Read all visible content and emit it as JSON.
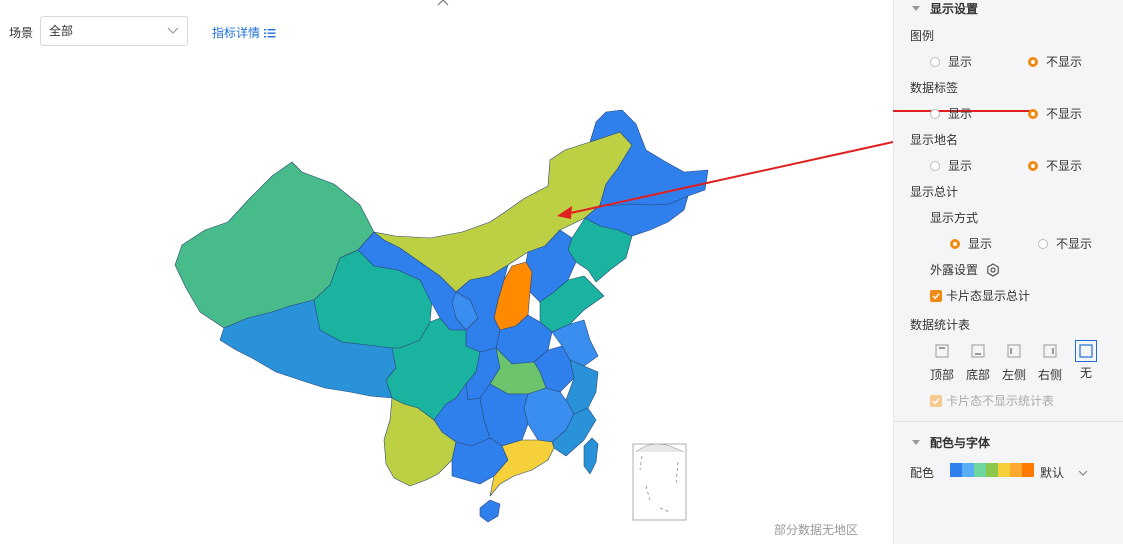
{
  "toolbar": {
    "scene_label": "场景",
    "scene_value": "全部",
    "metric_link": "指标详情"
  },
  "map": {
    "nodata_text": "部分数据无地区",
    "colors": {
      "blue": "#2f80ed",
      "blue_alt": "#3a8ef0",
      "green": "#48bb8a",
      "teal": "#1ab3a0",
      "lime": "#bdd043",
      "orange": "#ff8a00",
      "yellow": "#f5d03a",
      "steel": "#2992d9",
      "light_green": "#6cc46c"
    }
  },
  "panel": {
    "display_settings": "显示设置",
    "legend": {
      "label": "图例",
      "show": "显示",
      "hide": "不显示",
      "selected": "hide"
    },
    "data_labels": {
      "label": "数据标签",
      "show": "显示",
      "hide": "不显示",
      "selected": "hide"
    },
    "place_names": {
      "label": "显示地名",
      "show": "显示",
      "hide": "不显示",
      "selected": "hide"
    },
    "total": {
      "label": "显示总计",
      "mode_label": "显示方式",
      "show": "显示",
      "hide": "不显示",
      "selected": "show",
      "exposure_label": "外露设置",
      "card_total": "卡片态显示总计"
    },
    "stats_table": {
      "label": "数据统计表",
      "positions": [
        "顶部",
        "底部",
        "左侧",
        "右侧",
        "无"
      ],
      "selected": "无",
      "card_hide": "卡片态不显示统计表"
    },
    "color_font": "配色与字体",
    "palette_label": "配色",
    "palette_value": "默认",
    "palette_colors": [
      "#2f80ed",
      "#5aaef5",
      "#6fd6a0",
      "#8cc84b",
      "#f5d03a",
      "#ffa92e",
      "#ff7a00"
    ]
  }
}
